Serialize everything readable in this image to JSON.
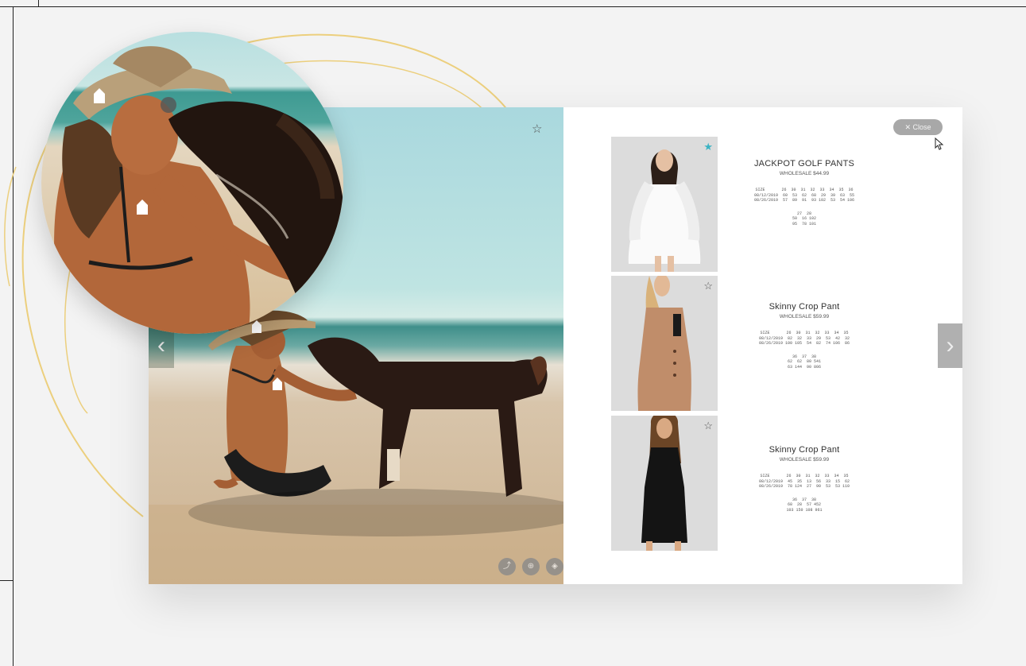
{
  "hero": {
    "favorite_icon": "star-outline-icon",
    "nav_prev": "‹",
    "nav_next": "›"
  },
  "close_button": {
    "label": "✕  Close"
  },
  "products": [
    {
      "name": "JACKPOT GOLF PANTS",
      "price": "WHOLESALE $44.99",
      "favorited": true,
      "sizes_block_1": "SIZE       26  30  31  32  33  34  35  36\n08/12/2019  60  53  62  68  29  39  63  55\n08/26/2019  57  89  91  93 102  53  54 106",
      "sizes_block_2": "27  28\n50  16 102\n95  78 101"
    },
    {
      "name": "Skinny Crop Pant",
      "price": "WHOLESALE $59.99",
      "favorited": false,
      "sizes_block_1": "SIZE       26  30  31  32  33  34  35\n08/12/2019  82  32  33  29  53  42  32\n08/26/2019 100 105  54  82  74 106  86",
      "sizes_block_2": "36  37  38\n62  62  80 541\n63 144  90 806"
    },
    {
      "name": "Skinny Crop Pant",
      "price": "WHOLESALE $59.99",
      "favorited": false,
      "sizes_block_1": "SIZE       26  30  31  32  33  34  35\n08/12/2019  45  35  13  56  33  15  62\n08/26/2019  78 124  27  90  53  53 110",
      "sizes_block_2": "36  37  38\n68  28  57 452\n103 150 108 961"
    }
  ],
  "toolbar_icons": [
    "share-icon",
    "zoom-icon",
    "tag-icon",
    "grid-icon",
    "comment-icon"
  ],
  "colors": {
    "accent": "#3bb3c3",
    "swirl": "#eccf7d"
  }
}
